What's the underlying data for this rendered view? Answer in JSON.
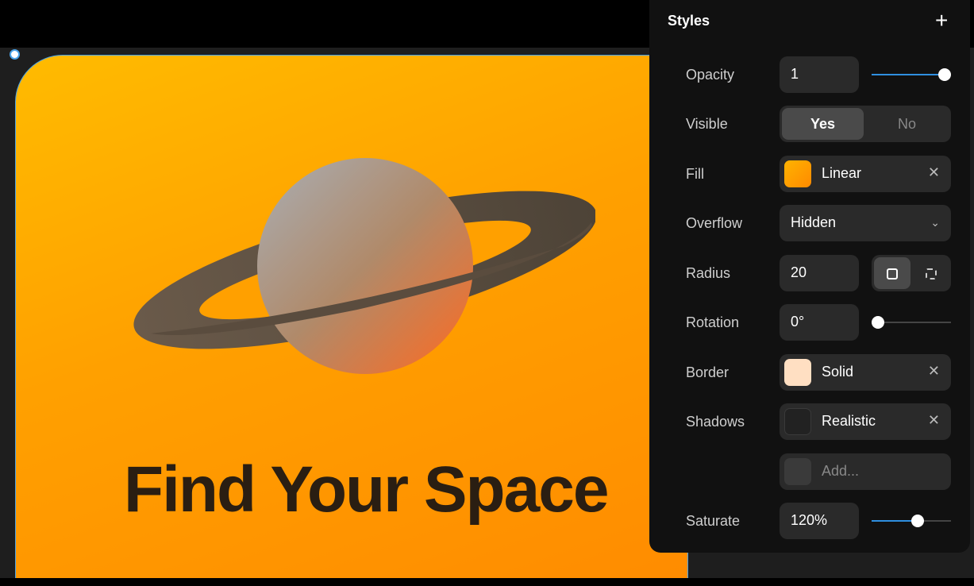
{
  "canvas": {
    "headline": "Find Your Space"
  },
  "panel": {
    "title": "Styles",
    "opacity": {
      "label": "Opacity",
      "value": "1",
      "slider": 1.0
    },
    "visible": {
      "label": "Visible",
      "yes": "Yes",
      "no": "No",
      "selected": "Yes"
    },
    "fill": {
      "label": "Fill",
      "value": "Linear",
      "color": "#ff9d00"
    },
    "overflow": {
      "label": "Overflow",
      "value": "Hidden"
    },
    "radius": {
      "label": "Radius",
      "value": "20"
    },
    "rotation": {
      "label": "Rotation",
      "value": "0°",
      "slider": 0
    },
    "border": {
      "label": "Border",
      "value": "Solid",
      "color": "#ffdfc2"
    },
    "shadows": {
      "label": "Shadows",
      "value": "Realistic",
      "add": "Add..."
    },
    "saturate": {
      "label": "Saturate",
      "value": "120%",
      "slider": 0.6
    }
  },
  "colors": {
    "accent": "#2f8fe0",
    "selection": "#4aa3e8"
  }
}
